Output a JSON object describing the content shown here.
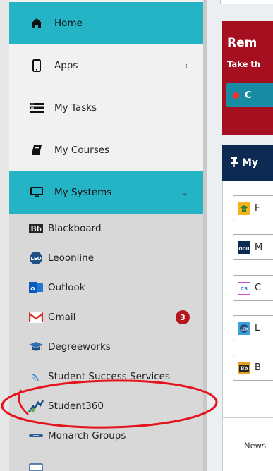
{
  "nav": {
    "home": "Home",
    "apps": "Apps",
    "my_tasks": "My Tasks",
    "my_courses": "My Courses",
    "my_systems": "My Systems"
  },
  "systems": {
    "blackboard": "Blackboard",
    "leoonline": "Leoonline",
    "outlook": "Outlook",
    "gmail": "Gmail",
    "gmail_count": "3",
    "degreeworks": "Degreeworks",
    "student_success": "Student Success Services",
    "student360": "Student360",
    "monarch_groups": "Monarch Groups"
  },
  "main": {
    "reminder_title": "Rem",
    "reminder_sub": "Take th",
    "reminder_btn": "C",
    "my_header": "My",
    "tiles": [
      "F",
      "M",
      "C",
      "L",
      "B"
    ],
    "news_tab": "News"
  },
  "colors": {
    "active": "#25b3c6",
    "badge": "#b3161d",
    "reminder": "#a50f1f",
    "header": "#0d2a53",
    "annotation": "#e3141c"
  }
}
